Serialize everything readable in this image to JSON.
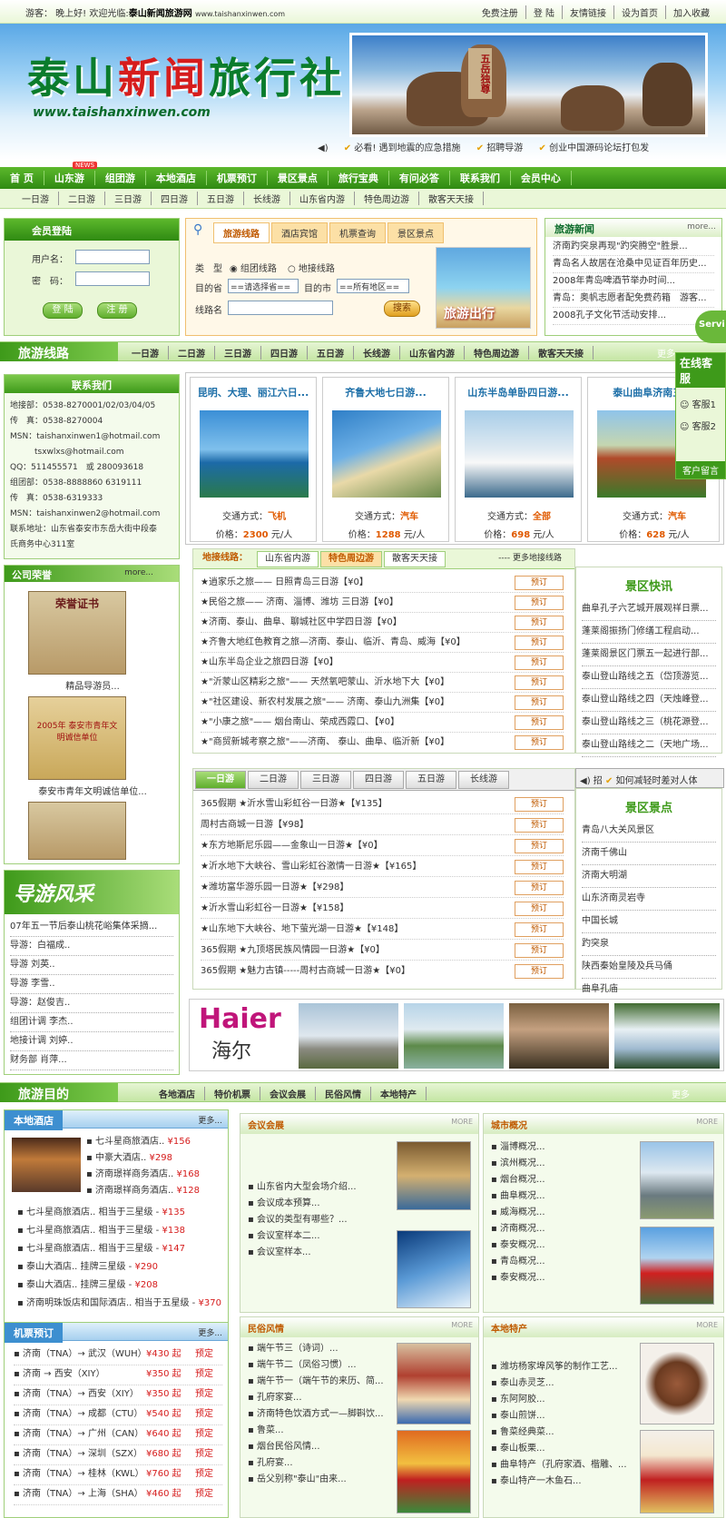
{
  "topbar": {
    "greeting": "游客： 晚上好! 欢迎光临:",
    "site": "泰山新闻旅游网",
    "url": "www.taishanxinwen.com",
    "links": [
      "免费注册",
      "登 陆",
      "友情链接",
      "设为首页",
      "加入收藏"
    ]
  },
  "banner": {
    "logo_a": "泰山",
    "logo_red": "新闻",
    "logo_b": "旅行社",
    "url": "www.taishanxinwen.com",
    "stone_text": "五岳独尊",
    "marquee": [
      "必看! 遇到地震的应急措施",
      "招聘导游",
      "创业中国源码论坛打包发"
    ]
  },
  "nav1": [
    "首 页",
    "山东游",
    "组团游",
    "本地酒店",
    "机票预订",
    "景区景点",
    "旅行宝典",
    "有问必答",
    "联系我们",
    "会员中心"
  ],
  "nav1_badge": "NEWS",
  "nav2": [
    "一日游",
    "二日游",
    "三日游",
    "四日游",
    "五日游",
    "长线游",
    "山东省内游",
    "特色周边游",
    "散客天天接"
  ],
  "login": {
    "title": "会员登陆",
    "user": "用户名：",
    "pass": "密　码：",
    "login_btn": "登 陆",
    "reg_btn": "注 册"
  },
  "search": {
    "tabs": [
      "旅游线路",
      "酒店宾馆",
      "机票查询",
      "景区景点"
    ],
    "type_label": "类　型",
    "radio1": "组团线路",
    "radio2": "地接线路",
    "from_label": "目的省",
    "from_val": "==请选择省==",
    "city_label": "目的市",
    "city_val": "==所有地区==",
    "name_label": "线路名",
    "btn": "搜索",
    "img_text": "旅游出行"
  },
  "news": {
    "title": "旅游新闻",
    "more": "more...",
    "items": [
      "济南趵突泉再现\"趵突腾空\"胜景...",
      "青岛名人故居在沧桑中见证百年历史...",
      "2008年青岛啤酒节举办时间...",
      "青岛：奥帆志愿者配免费药箱　游客...",
      "2008孔子文化节活动安排..."
    ]
  },
  "routes_bar": {
    "title": "旅游线路",
    "items": [
      "一日游",
      "二日游",
      "三日游",
      "四日游",
      "五日游",
      "长线游",
      "山东省内游",
      "特色周边游",
      "散客天天接"
    ],
    "more": "更多"
  },
  "contact": {
    "title": "联系我们",
    "lines": [
      "地接部：0538-8270001/02/03/04/05",
      "传　真：0538-8270004",
      "MSN：taishanxinwen1@hotmail.com",
      "　　　tsxwlxs@hotmail.com",
      "QQ：511455571　或 280093618",
      "组团部：0538-8888860 6319111",
      "传　真：0538-6319333",
      "MSN：taishanxinwen2@hotmail.com",
      "联系地址：山东省泰安市东岳大街中段泰",
      "氏商务中心311室"
    ]
  },
  "tours": [
    {
      "title": "昆明、大理、丽江六日...",
      "traffic_label": "交通方式：",
      "traffic": "飞机",
      "price_label": "价格：",
      "price": "2300",
      "unit": "元/人"
    },
    {
      "title": "齐鲁大地七日游...",
      "traffic_label": "交通方式：",
      "traffic": "汽车",
      "price_label": "价格：",
      "price": "1288",
      "unit": "元/人"
    },
    {
      "title": "山东半岛单卧四日游...",
      "traffic_label": "交通方式：",
      "traffic": "全部",
      "price_label": "价格：",
      "price": "698",
      "unit": "元/人"
    },
    {
      "title": "泰山曲阜济南三...",
      "traffic_label": "交通方式：",
      "traffic": "汽车",
      "price_label": "价格：",
      "price": "628",
      "unit": "元/人"
    }
  ],
  "online": {
    "title": "在线客服",
    "agents": [
      "客服1",
      "客服2"
    ],
    "msg": "客户留言",
    "serv": "Servi"
  },
  "honor": {
    "title": "公司荣誉",
    "more": "more...",
    "caps": [
      "精品导游员...",
      "泰安市青年文明诚信单位..."
    ],
    "cert1": "荣誉证书",
    "cert2": "2005年 泰安市青年文明诚信单位"
  },
  "guide": {
    "title": "导游风采",
    "items": [
      "07年五一节后泰山桃花峪集体采摘...",
      "导游：白福成..",
      "导游 刘英..",
      "导游 李雪..",
      "导游：赵俊吉..",
      "组团计调 李杰..",
      "地接计调 刘婷..",
      "财务部 肖萍..."
    ]
  },
  "list2": {
    "label": "地接线路：",
    "tabs": [
      "山东省内游",
      "特色周边游",
      "散客天天接"
    ],
    "more": "---- 更多地接线路",
    "book": "预订",
    "rows": [
      "★逍家乐之旅—— 日照青岛三日游【¥0】",
      "★民俗之旅—— 济南、淄博、潍坊 三日游【¥0】",
      "★济南、泰山、曲阜、聊城社区中学四日游【¥0】",
      "★齐鲁大地红色教育之旅—济南、泰山、临沂、青岛、威海【¥0】",
      "★山东半岛企业之旅四日游【¥0】",
      "★\"沂蒙山区精彩之旅\"—— 天然氧吧蒙山、沂水地下大【¥0】",
      "★\"社区建设、新农村发展之旅\"—— 济南、泰山九洲集【¥0】",
      "★\"小康之旅\"—— 烟台南山、荣成西霞口、【¥0】",
      "★\"商贸新城考察之旅\"——济南、 泰山、曲阜、临沂新【¥0】"
    ]
  },
  "scenic_news": {
    "title": "景区快讯",
    "items": [
      "曲阜孔子六艺城开展观祥日票...",
      "蓬莱阁振扬门修缮工程启动...",
      "蓬莱阁景区门票五一起进行部...",
      "泰山登山路线之五（岱顶游览...",
      "泰山登山路线之四（天烛峰登...",
      "泰山登山路线之三（桃花源登...",
      "泰山登山路线之二（天地广场..."
    ]
  },
  "list3": {
    "tabs": [
      "一日游",
      "二日游",
      "三日游",
      "四日游",
      "五日游",
      "长线游"
    ],
    "tip": "招",
    "tip2": "如何减轻时差对人体",
    "book": "预订",
    "rows": [
      "365假期 ★沂水雪山彩虹谷一日游★【¥135】",
      "周村古商城一日游【¥98】",
      "★东方地斯尼乐园——金象山一日游★【¥0】",
      "★沂水地下大峡谷、雪山彩虹谷激情一日游★【¥165】",
      "★潍坊富华游乐园一日游★【¥298】",
      "★沂水雪山彩虹谷一日游★【¥158】",
      "★山东地下大峡谷、地下萤光湖一日游★【¥148】",
      "365假期 ★九顶塔民族风情园一日游★【¥0】",
      "365假期 ★魅力古镇-----周村古商城一日游★【¥0】"
    ]
  },
  "scenic": {
    "title": "景区景点",
    "items": [
      "青岛八大关风景区",
      "济南千佛山",
      "济南大明湖",
      "山东济南灵岩寺",
      "中国长城",
      "趵突泉",
      "陕西秦始皇陵及兵马俑",
      "曲阜孔庙"
    ]
  },
  "ads": {
    "haier": "Haier",
    "haier_cn": "海尔"
  },
  "dest_bar": {
    "title": "旅游目的",
    "items": [
      "各地酒店",
      "特价机票",
      "会议会展",
      "民俗风情",
      "本地特产"
    ],
    "more": "更多"
  },
  "hotel": {
    "title": "本地酒店",
    "more": "更多...",
    "top": [
      {
        "n": "七斗星商旅酒店..",
        "p": "¥156"
      },
      {
        "n": "中豪大酒店..",
        "p": "¥298"
      },
      {
        "n": "济南璟祥商务酒店..",
        "p": "¥168"
      },
      {
        "n": "济南璟祥商务酒店..",
        "p": "¥128"
      }
    ],
    "rows": [
      {
        "n": "七斗星商旅酒店.. 相当于三星级 -",
        "p": "¥135"
      },
      {
        "n": "七斗星商旅酒店.. 相当于三星级 -",
        "p": "¥138"
      },
      {
        "n": "七斗星商旅酒店.. 相当于三星级 -",
        "p": "¥147"
      },
      {
        "n": "泰山大酒店.. 挂牌三星级 -",
        "p": "¥290"
      },
      {
        "n": "泰山大酒店.. 挂牌三星级 -",
        "p": "¥208"
      },
      {
        "n": "济南明珠饭店和国际酒店.. 相当于五星级 -",
        "p": "¥370"
      }
    ]
  },
  "flight": {
    "title": "机票预订",
    "more": "更多...",
    "book": "预定",
    "rows": [
      {
        "r": "济南（TNA）→ 武汉（WUH）",
        "p": "¥430 起"
      },
      {
        "r": "济南 → 西安（XIY）",
        "p": "¥350 起"
      },
      {
        "r": "济南（TNA）→ 西安（XIY）",
        "p": "¥350 起"
      },
      {
        "r": "济南（TNA）→ 成都（CTU）",
        "p": "¥540 起"
      },
      {
        "r": "济南（TNA）→ 广州（CAN）",
        "p": "¥640 起"
      },
      {
        "r": "济南（TNA）→ 深圳（SZX）",
        "p": "¥680 起"
      },
      {
        "r": "济南（TNA）→ 桂林（KWL）",
        "p": "¥760 起"
      },
      {
        "r": "济南（TNA）→ 上海（SHA）",
        "p": "¥460 起"
      }
    ]
  },
  "meeting": {
    "title": "会议会展",
    "more": "MORE",
    "items": [
      "山东省内大型会场介绍...",
      "会议成本预算...",
      "会议的类型有哪些？...",
      "会议室样本二...",
      "会议室样本..."
    ]
  },
  "city": {
    "title": "城市概况",
    "more": "MORE",
    "items": [
      "淄博概况...",
      "滨州概况...",
      "烟台概况...",
      "曲阜概况...",
      "威海概况...",
      "济南概况...",
      "泰安概况...",
      "青岛概况...",
      "泰安概况..."
    ]
  },
  "folk": {
    "title": "民俗风情",
    "more": "MORE",
    "items": [
      "端午节三（诗词）...",
      "端午节二（凤俗习惯）...",
      "端午节一（端午节的来历、简...",
      "孔府家宴...",
      "济南特色饮酒方式一—脚斟饮...",
      "鲁菜...",
      "烟台民俗风情...",
      "孔府宴...",
      "岳父别称\"泰山\"由来..."
    ]
  },
  "special": {
    "title": "本地特产",
    "more": "MORE",
    "items": [
      "潍坊杨家埠风筝的制作工艺...",
      "泰山赤灵芝...",
      "东阿阿胶...",
      "泰山煎饼...",
      "鲁菜经典菜...",
      "泰山板栗...",
      "曲阜特产（孔府家酒、楷雕、...",
      "泰山特产一木鱼石..."
    ]
  }
}
